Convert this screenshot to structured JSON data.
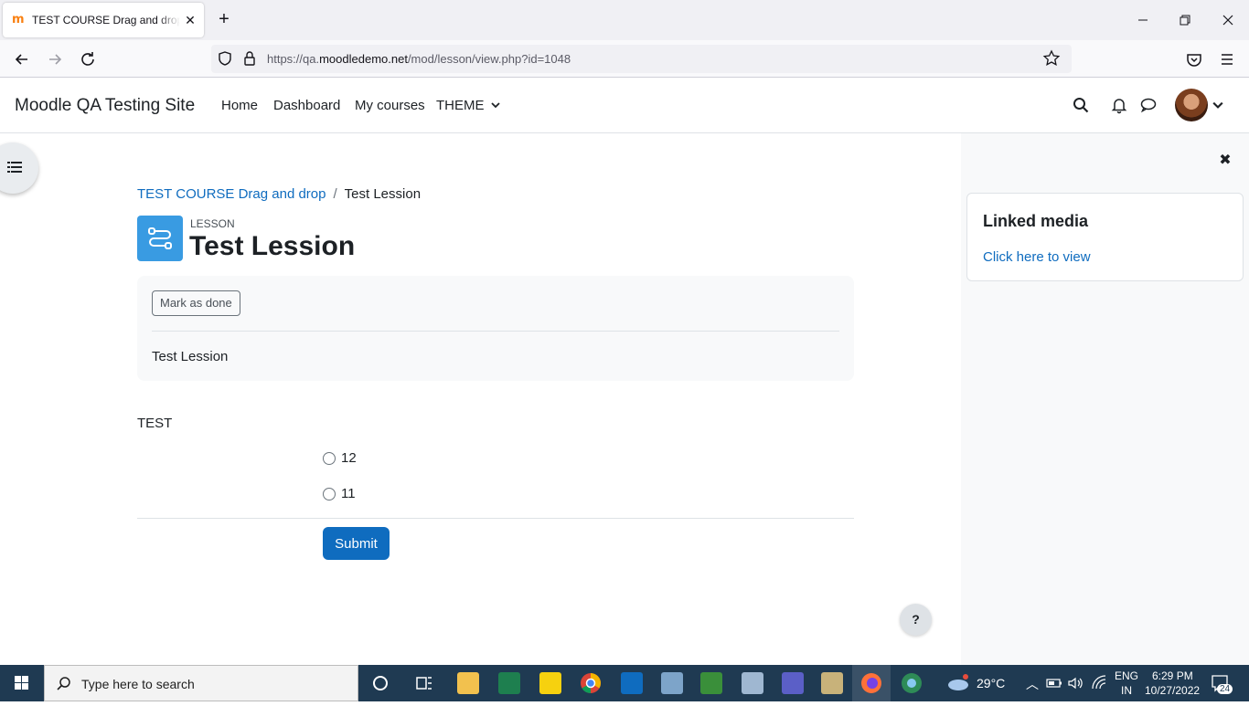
{
  "browser": {
    "tab_title": "TEST COURSE Drag and drop: Test Lession",
    "favicon_glyph": "m",
    "url_prefix": "https://qa.",
    "url_host": "moodledemo.net",
    "url_path": "/mod/lesson/view.php?id=1048"
  },
  "header": {
    "site_name": "Moodle QA Testing Site",
    "nav": [
      "Home",
      "Dashboard",
      "My courses",
      "THEME"
    ]
  },
  "breadcrumb": {
    "course": "TEST COURSE Drag and drop",
    "separator": "/",
    "current": "Test Lession"
  },
  "activity": {
    "module_type": "LESSON",
    "title": "Test Lession",
    "mark_done_label": "Mark as done",
    "description": "Test Lession"
  },
  "question": {
    "text": "TEST",
    "answers": [
      "12",
      "11"
    ],
    "submit_label": "Submit"
  },
  "help_label": "?",
  "right_drawer": {
    "block_title": "Linked media",
    "block_link": "Click here to view"
  },
  "taskbar": {
    "search_placeholder": "Type here to search",
    "weather": "29°C",
    "lang_top": "ENG",
    "lang_bottom": "IN",
    "time": "6:29 PM",
    "date": "10/27/2022",
    "notification_count": "24"
  },
  "colors": {
    "moodle_blue": "#0f6cbf",
    "lesson_icon": "#399be2",
    "taskbar": "#1f3a52"
  }
}
